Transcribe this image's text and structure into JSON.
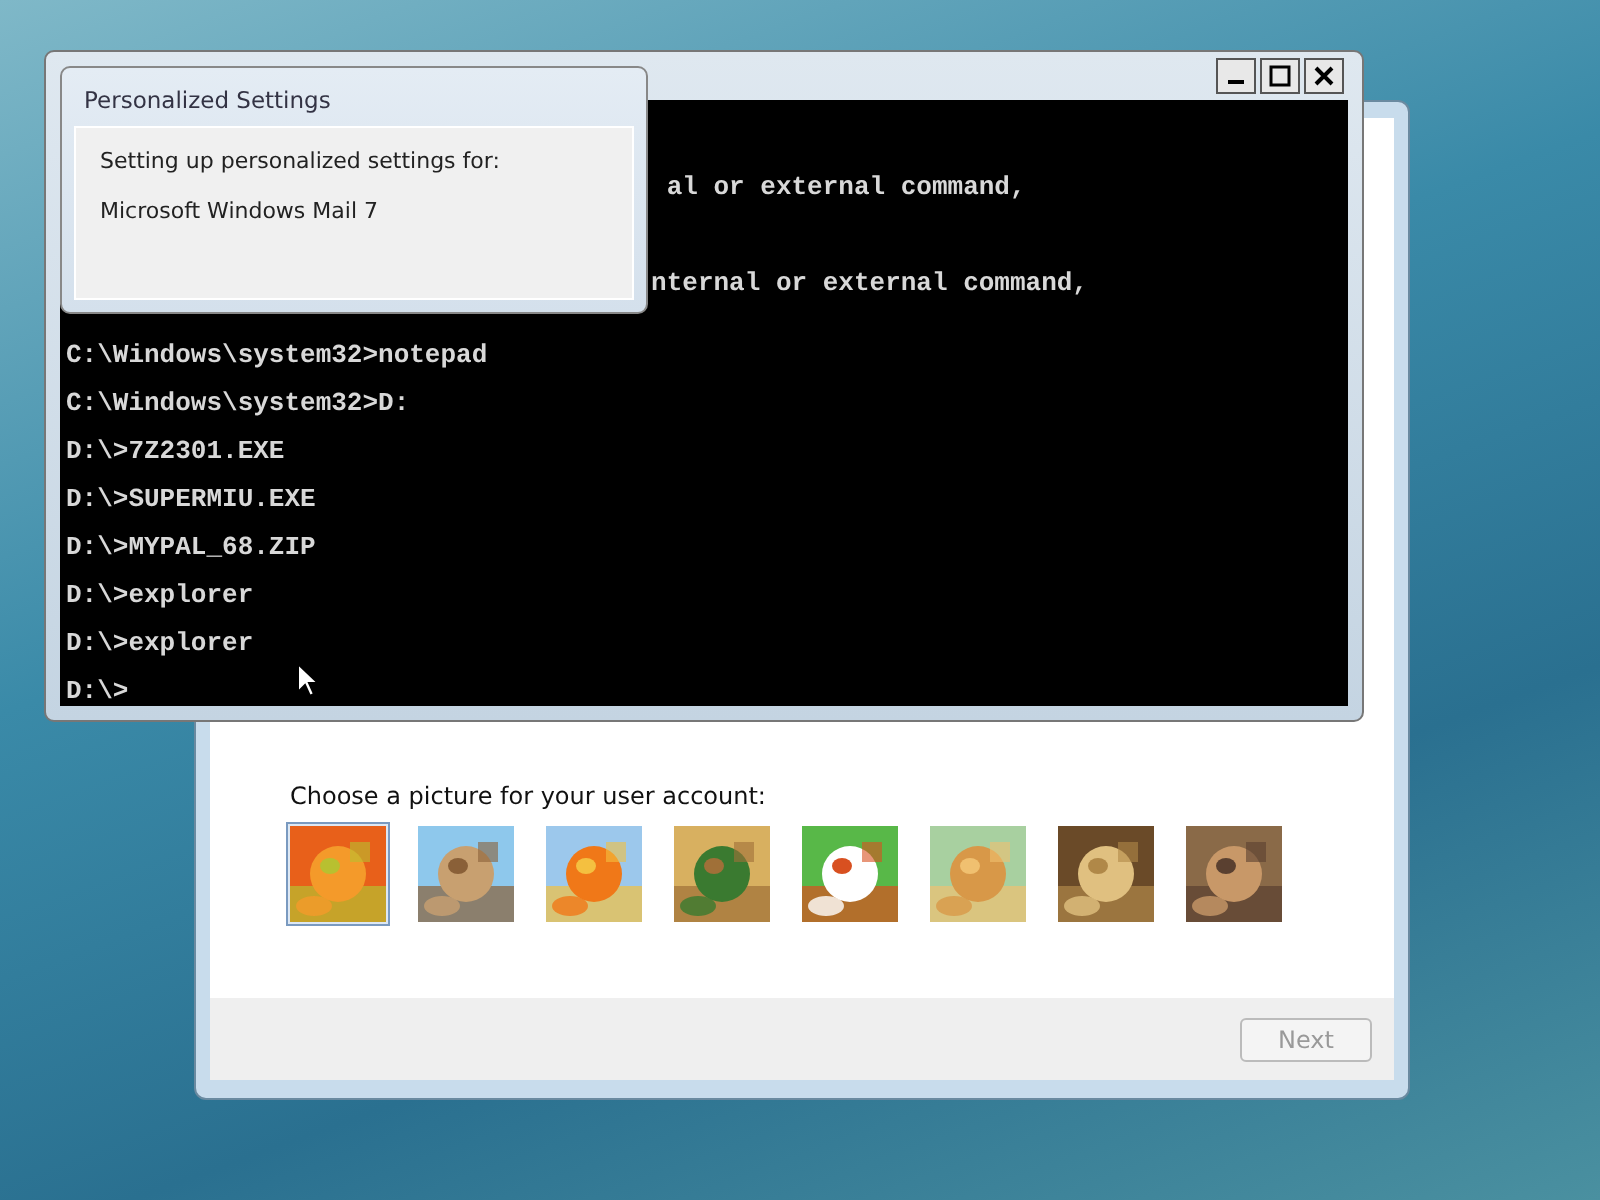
{
  "setup_window": {
    "prompt": "Choose a picture for your user account:",
    "pictures": [
      {
        "kind": "picture",
        "selected": true
      },
      {
        "kind": "picture",
        "selected": false
      },
      {
        "kind": "picture",
        "selected": false
      },
      {
        "kind": "picture",
        "selected": false
      },
      {
        "kind": "picture",
        "selected": false
      },
      {
        "kind": "picture",
        "selected": false
      },
      {
        "kind": "picture",
        "selected": false
      },
      {
        "kind": "picture",
        "selected": false
      }
    ],
    "next_button": {
      "label": "Next",
      "disabled": true
    }
  },
  "console_window": {
    "lines": [
      "al or external command,",
      "nternal or external command,",
      "C:\\Windows\\system32>notepad",
      "C:\\Windows\\system32>D:",
      "D:\\>7Z2301.EXE",
      "D:\\>SUPERMIU.EXE",
      "D:\\>MYPAL_68.ZIP",
      "D:\\>explorer",
      "D:\\>explorer",
      "D:\\>"
    ]
  },
  "popup": {
    "title": "Personalized Settings",
    "message": "Setting up personalized settings for:",
    "item": "Microsoft Windows Mail 7"
  }
}
